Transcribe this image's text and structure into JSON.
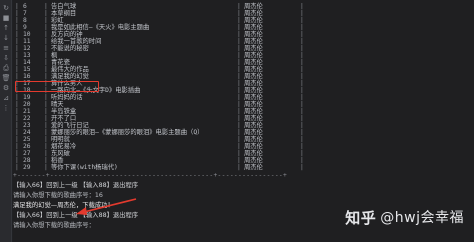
{
  "toolbar": {
    "icons": [
      {
        "name": "rerun-icon",
        "glyph": "↻"
      },
      {
        "name": "stop-icon",
        "glyph": "■"
      },
      {
        "name": "up-icon",
        "glyph": "↑"
      },
      {
        "name": "down-icon",
        "glyph": "↓"
      },
      {
        "name": "wrap-icon",
        "glyph": "≡"
      },
      {
        "name": "scroll-icon",
        "glyph": "⇩"
      },
      {
        "name": "print-icon",
        "glyph": "⎙"
      },
      {
        "name": "clear-icon",
        "glyph": "🗑"
      },
      {
        "name": "settings-icon",
        "glyph": "⚙"
      },
      {
        "name": "pin-icon",
        "glyph": "⊿"
      },
      {
        "name": "more-icon",
        "glyph": "⋮"
      }
    ]
  },
  "table": {
    "rows": [
      {
        "num": "6",
        "song": "告白气球",
        "singer": "周杰伦"
      },
      {
        "num": "7",
        "song": "本草纲目",
        "singer": "周杰伦"
      },
      {
        "num": "8",
        "song": "彩虹",
        "singer": "周杰伦"
      },
      {
        "num": "9",
        "song": "我是如此相信—《天火》电影主题曲",
        "singer": "周杰伦"
      },
      {
        "num": "10",
        "song": "反方向的钟",
        "singer": "周杰伦"
      },
      {
        "num": "11",
        "song": "给我一首歌的时间",
        "singer": "周杰伦"
      },
      {
        "num": "12",
        "song": "不能说的秘密",
        "singer": "周杰伦"
      },
      {
        "num": "13",
        "song": "枫",
        "singer": "周杰伦"
      },
      {
        "num": "14",
        "song": "青花瓷",
        "singer": "周杰伦"
      },
      {
        "num": "15",
        "song": "最伟大的作品",
        "singer": "周杰伦"
      },
      {
        "num": "16",
        "song": "满足我的幻觉",
        "singer": "周杰伦"
      },
      {
        "num": "17",
        "song": "算什么男人",
        "singer": "周杰伦"
      },
      {
        "num": "18",
        "song": "一路向北—《头文字D》电影插曲",
        "singer": "周杰伦"
      },
      {
        "num": "19",
        "song": "听妈妈的话",
        "singer": "周杰伦"
      },
      {
        "num": "20",
        "song": "晴天",
        "singer": "周杰伦"
      },
      {
        "num": "21",
        "song": "半岛铁盒",
        "singer": "周杰伦"
      },
      {
        "num": "22",
        "song": "开不了口",
        "singer": "周杰伦"
      },
      {
        "num": "23",
        "song": "爱的飞行日记",
        "singer": "周杰伦"
      },
      {
        "num": "24",
        "song": "蒙娜丽莎的眼泪—《蒙娜丽莎的眼泪》电影主题曲（Q）",
        "singer": "周杰伦"
      },
      {
        "num": "25",
        "song": "明明就",
        "singer": "周杰伦"
      },
      {
        "num": "26",
        "song": "烟花易冷",
        "singer": "周杰伦"
      },
      {
        "num": "27",
        "song": "东风破",
        "singer": "周杰伦"
      },
      {
        "num": "28",
        "song": "稻香",
        "singer": "周杰伦"
      },
      {
        "num": "29",
        "song": "等你下课(with杨瑞代)",
        "singer": "周杰伦"
      }
    ],
    "divider": "+-------+----------------------------------------+----------------+"
  },
  "console": {
    "menu_line_1": "【输入66】回到上一级  【输入88】退出程序",
    "prompt_1": "请输入你想下载的歌曲序号：16",
    "result_line": "满足我的幻觉—周杰伦，下载成功！",
    "menu_line_2": "【输入66】回到上一级  【输入88】退出程序",
    "prompt_2": "请输入你想下载的歌曲序号："
  },
  "watermark": {
    "brand": "知乎",
    "handle": "@hwj会幸福"
  }
}
